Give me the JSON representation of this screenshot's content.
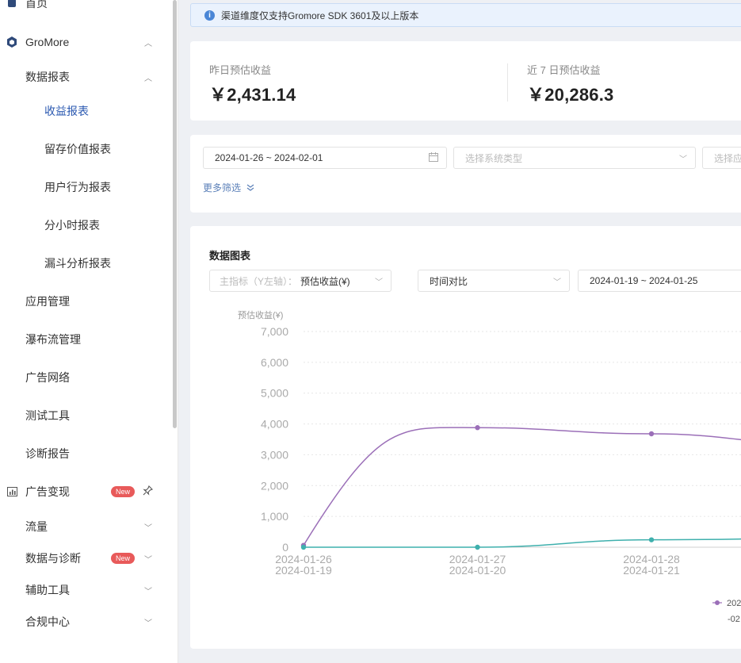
{
  "sidebar": {
    "home": "首页",
    "gromore": "GroMore",
    "data_reports": "数据报表",
    "reports": [
      "收益报表",
      "留存价值报表",
      "用户行为报表",
      "分小时报表",
      "漏斗分析报表"
    ],
    "menus": [
      "应用管理",
      "瀑布流管理",
      "广告网络",
      "测试工具",
      "诊断报告"
    ],
    "ad_monetize": "广告变现",
    "new_badge": "New",
    "traffic": "流量",
    "data_diag": "数据与诊断",
    "tools": "辅助工具",
    "compliance": "合规中心"
  },
  "notice": {
    "text": "渠道维度仅支持Gromore SDK 3601及以上版本"
  },
  "stats": {
    "yesterday_label": "昨日预估收益",
    "yesterday_value": "￥2,431.14",
    "week_label": "近 7 日预估收益",
    "week_value": "￥20,286.3"
  },
  "filters": {
    "date_range": "2024-01-26 ~ 2024-02-01",
    "system_placeholder": "选择系统类型",
    "app_placeholder": "选择应",
    "more": "更多筛选"
  },
  "chart_card": {
    "title": "数据图表",
    "metric_prefix": "主指标（Y左轴）：",
    "metric_value": "预估收益(¥)",
    "compare_value": "时间对比",
    "compare_range": "2024-01-19 ~ 2024-01-25"
  },
  "chart_data": {
    "type": "line",
    "ylabel": "预估收益(¥)",
    "ylim": [
      0,
      7000
    ],
    "yticks": [
      "0",
      "1,000",
      "2,000",
      "3,000",
      "4,000",
      "5,000",
      "6,000",
      "7,000"
    ],
    "categories": [
      "2024-01-26",
      "2024-01-27",
      "2024-01-28"
    ],
    "categories_compare": [
      "2024-01-19",
      "2024-01-20",
      "2024-01-21"
    ],
    "series": [
      {
        "name": "",
        "color": "#9b6fb8",
        "values": [
          60,
          3880,
          3680,
          3320
        ]
      },
      {
        "name": "",
        "color": "#3fb0ad",
        "values": [
          0,
          0,
          240,
          290
        ]
      }
    ],
    "legend": [
      "202",
      "-02"
    ],
    "grid": true
  }
}
